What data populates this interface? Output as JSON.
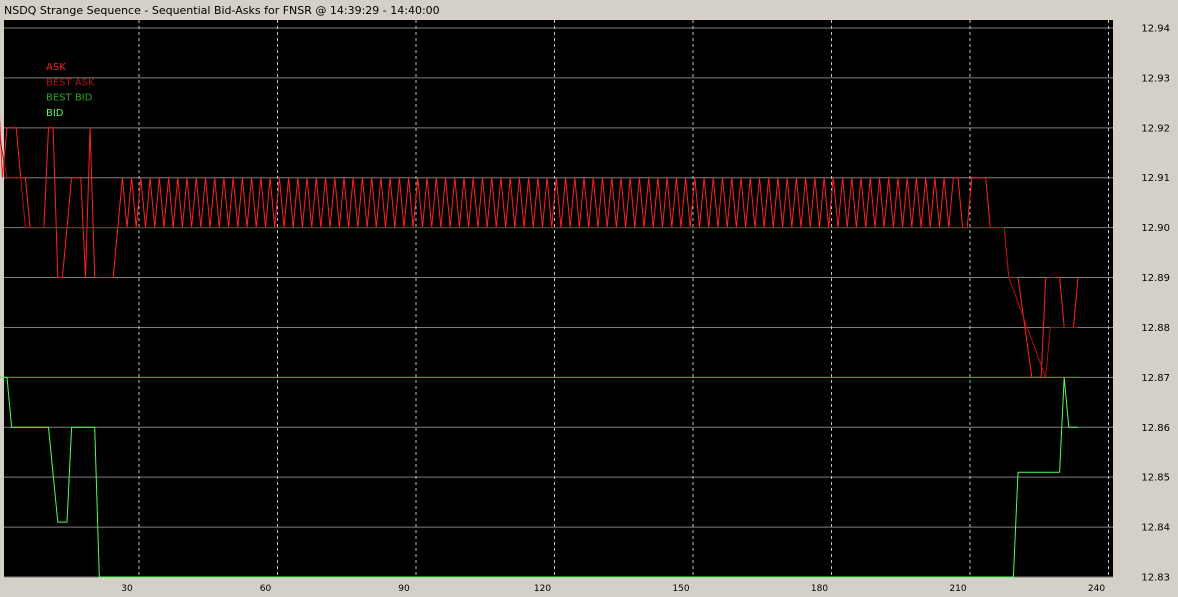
{
  "window": {
    "title": "NSDQ Strange Sequence - Sequential Bid-Asks for FNSR @ 14:39:29 - 14:40:00"
  },
  "colors": {
    "background": "#000000",
    "grid_h": "#808080",
    "grid_v": "#c0c0c0",
    "ask": "#ff2020",
    "best_ask": "#b01010",
    "best_bid": "#28a828",
    "bid": "#50ff50"
  },
  "chart_data": {
    "type": "line",
    "title": "NSDQ Strange Sequence - Sequential Bid-Asks for FNSR @ 14:39:29 - 14:40:00",
    "xlabel": "",
    "ylabel": "",
    "xlim": [
      1,
      241
    ],
    "ylim": [
      12.83,
      12.94
    ],
    "grid": true,
    "legend_position": "top-left",
    "x_ticks": [
      30,
      60,
      90,
      120,
      150,
      180,
      210,
      240
    ],
    "y_ticks": [
      "12.83",
      "12.84",
      "12.85",
      "12.86",
      "12.87",
      "12.88",
      "12.89",
      "12.90",
      "12.91",
      "12.92",
      "12.93",
      "12.94"
    ],
    "legend": [
      "ASK",
      "BEST ASK",
      "BEST BID",
      "BID"
    ],
    "series": [
      {
        "name": "ASK",
        "color": "#ff2020",
        "points": [
          [
            1,
            12.93
          ],
          [
            2,
            12.93
          ],
          [
            3,
            12.91
          ],
          [
            4,
            12.92
          ],
          [
            6,
            12.92
          ],
          [
            7,
            12.91
          ],
          [
            8,
            12.91
          ],
          [
            9,
            12.9
          ],
          [
            12,
            12.9
          ],
          [
            13,
            12.92
          ],
          [
            14,
            12.92
          ],
          [
            15,
            12.89
          ],
          [
            16,
            12.89
          ],
          [
            18,
            12.91
          ],
          [
            20,
            12.91
          ],
          [
            21,
            12.89
          ],
          [
            22,
            12.92
          ],
          [
            23,
            12.89
          ],
          [
            25,
            12.89
          ],
          [
            27,
            12.89
          ],
          [
            28,
            12.9
          ],
          [
            29,
            12.91
          ],
          [
            210,
            12.91
          ],
          [
            211,
            12.9
          ],
          [
            212,
            12.9
          ],
          [
            213,
            12.91
          ],
          [
            216,
            12.91
          ],
          [
            217,
            12.9
          ],
          [
            220,
            12.9
          ],
          [
            221,
            12.89
          ],
          [
            223,
            12.89
          ],
          [
            226,
            12.87
          ],
          [
            228,
            12.87
          ],
          [
            229,
            12.89
          ],
          [
            232,
            12.89
          ],
          [
            233,
            12.88
          ],
          [
            235,
            12.88
          ],
          [
            236,
            12.89
          ]
        ]
      },
      {
        "name": "BEST ASK",
        "color": "#b01010",
        "points": [
          [
            1,
            12.93
          ],
          [
            2,
            12.92
          ],
          [
            4,
            12.91
          ],
          [
            7,
            12.91
          ],
          [
            8,
            12.9
          ],
          [
            29,
            12.9
          ],
          [
            220,
            12.9
          ],
          [
            221,
            12.89
          ],
          [
            229,
            12.87
          ],
          [
            230,
            12.88
          ],
          [
            236,
            12.88
          ]
        ]
      },
      {
        "name": "BEST BID",
        "color": "#28a828",
        "points": [
          [
            1,
            12.87
          ],
          [
            236,
            12.87
          ]
        ]
      },
      {
        "name": "BID",
        "color": "#50ff50",
        "points": [
          [
            1,
            12.853
          ],
          [
            2,
            12.87
          ],
          [
            4,
            12.87
          ],
          [
            5,
            12.86
          ],
          [
            13,
            12.86
          ],
          [
            15,
            12.841
          ],
          [
            17,
            12.841
          ],
          [
            18,
            12.86
          ],
          [
            23,
            12.86
          ],
          [
            24,
            12.83
          ],
          [
            222,
            12.83
          ],
          [
            223,
            12.851
          ],
          [
            232,
            12.851
          ],
          [
            233,
            12.87
          ],
          [
            234,
            12.86
          ],
          [
            236,
            12.86
          ]
        ]
      }
    ]
  }
}
